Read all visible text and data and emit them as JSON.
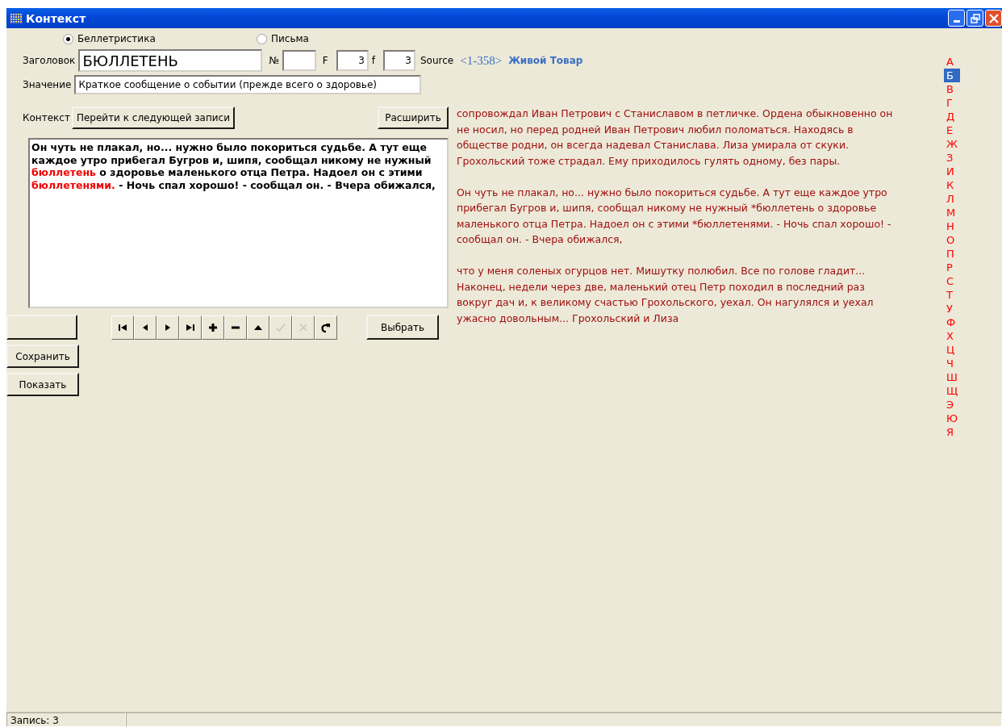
{
  "window": {
    "title": "Контекст"
  },
  "source_type": [
    {
      "label": "Беллетристика",
      "selected": true
    },
    {
      "label": "Письма",
      "selected": false
    }
  ],
  "header": {
    "label": "Заголовок",
    "value": "БЮЛЛЕТЕНЬ",
    "number_label": "№",
    "f_upper_label": "F",
    "f_upper_value": "3",
    "f_lower_label": "f",
    "f_lower_value": "3",
    "source_label": "Source",
    "source_range": "<1-358>",
    "source_title": "Живой Товар"
  },
  "meaning": {
    "label": "Значение",
    "value": "Краткое сообщение о событии (прежде всего о здоровье)"
  },
  "context": {
    "label": "Контекст",
    "next_button": "Перейти к следующей записи",
    "expand_button": "Расширить",
    "memo": [
      {
        "text": "Он чуть не плакал, но... нужно было покориться судьбе. А тут еще каждое утро прибегал Бугров и, шипя, сообщал никому не нужный ",
        "highlight": false
      },
      {
        "text": "бюллетень",
        "highlight": true
      },
      {
        "text": "  о здоровье маленького отца Петра. Надоел он с этими ",
        "highlight": false
      },
      {
        "text": "бюллетенями.",
        "highlight": true
      },
      {
        "text": " - Ночь спал хорошо! - сообщал он. - Вчера обижался,",
        "highlight": false
      }
    ]
  },
  "navigator": [
    {
      "kind": "first",
      "disabled": false
    },
    {
      "kind": "prior",
      "disabled": false
    },
    {
      "kind": "next",
      "disabled": false
    },
    {
      "kind": "last",
      "disabled": false
    },
    {
      "kind": "insert",
      "disabled": false
    },
    {
      "kind": "delete",
      "disabled": false
    },
    {
      "kind": "edit",
      "disabled": false
    },
    {
      "kind": "post",
      "disabled": true
    },
    {
      "kind": "cancel",
      "disabled": true
    },
    {
      "kind": "refresh",
      "disabled": false
    }
  ],
  "choose_button": "Выбрать",
  "side_buttons": [
    "Сохранить",
    "Показать"
  ],
  "excerpt": [
    "сопровождал Иван Петрович с Станиславом в петличке. Ордена обыкновенно он не носил, но перед родней Иван Петрович любил поломаться. Находясь в обществе родни, он всегда надевал Станислава. Лиза умирала от скуки. Грохольский тоже страдал. Ему приходилось гулять одному, без пары.",
    "Он чуть не плакал, но... нужно было покориться судьбе. А тут еще каждое утро прибегал Бугров и, шипя, сообщал никому не нужный *бюллетень  о здоровье маленького отца Петра. Надоел он с этими *бюллетенями. - Ночь спал хорошо! - сообщал он. - Вчера обижался,",
    "что у меня соленых огурцов нет. Мишутку полюбил. Все по голове гладит... Наконец, недели через две, маленький отец Петр походил в последний раз вокруг дач и, к великому счастью Грохольского, уехал. Он нагулялся и уехал ужасно довольным... Грохольский и Лиза"
  ],
  "alphabet": [
    {
      "letter": "А",
      "selected": false
    },
    {
      "letter": "Б",
      "selected": true
    },
    {
      "letter": "В",
      "selected": false
    },
    {
      "letter": "Г",
      "selected": false
    },
    {
      "letter": "Д",
      "selected": false
    },
    {
      "letter": "Е",
      "selected": false
    },
    {
      "letter": "Ж",
      "selected": false
    },
    {
      "letter": "З",
      "selected": false
    },
    {
      "letter": "И",
      "selected": false
    },
    {
      "letter": "К",
      "selected": false
    },
    {
      "letter": "Л",
      "selected": false
    },
    {
      "letter": "М",
      "selected": false
    },
    {
      "letter": "Н",
      "selected": false
    },
    {
      "letter": "О",
      "selected": false
    },
    {
      "letter": "П",
      "selected": false
    },
    {
      "letter": "Р",
      "selected": false
    },
    {
      "letter": "С",
      "selected": false
    },
    {
      "letter": "Т",
      "selected": false
    },
    {
      "letter": "У",
      "selected": false
    },
    {
      "letter": "Ф",
      "selected": false
    },
    {
      "letter": "Х",
      "selected": false
    },
    {
      "letter": "Ц",
      "selected": false
    },
    {
      "letter": "Ч",
      "selected": false
    },
    {
      "letter": "Ш",
      "selected": false
    },
    {
      "letter": "Щ",
      "selected": false
    },
    {
      "letter": "Э",
      "selected": false
    },
    {
      "letter": "Ю",
      "selected": false
    },
    {
      "letter": "Я",
      "selected": false
    }
  ],
  "status_bar": {
    "record": "Запись: 3"
  }
}
